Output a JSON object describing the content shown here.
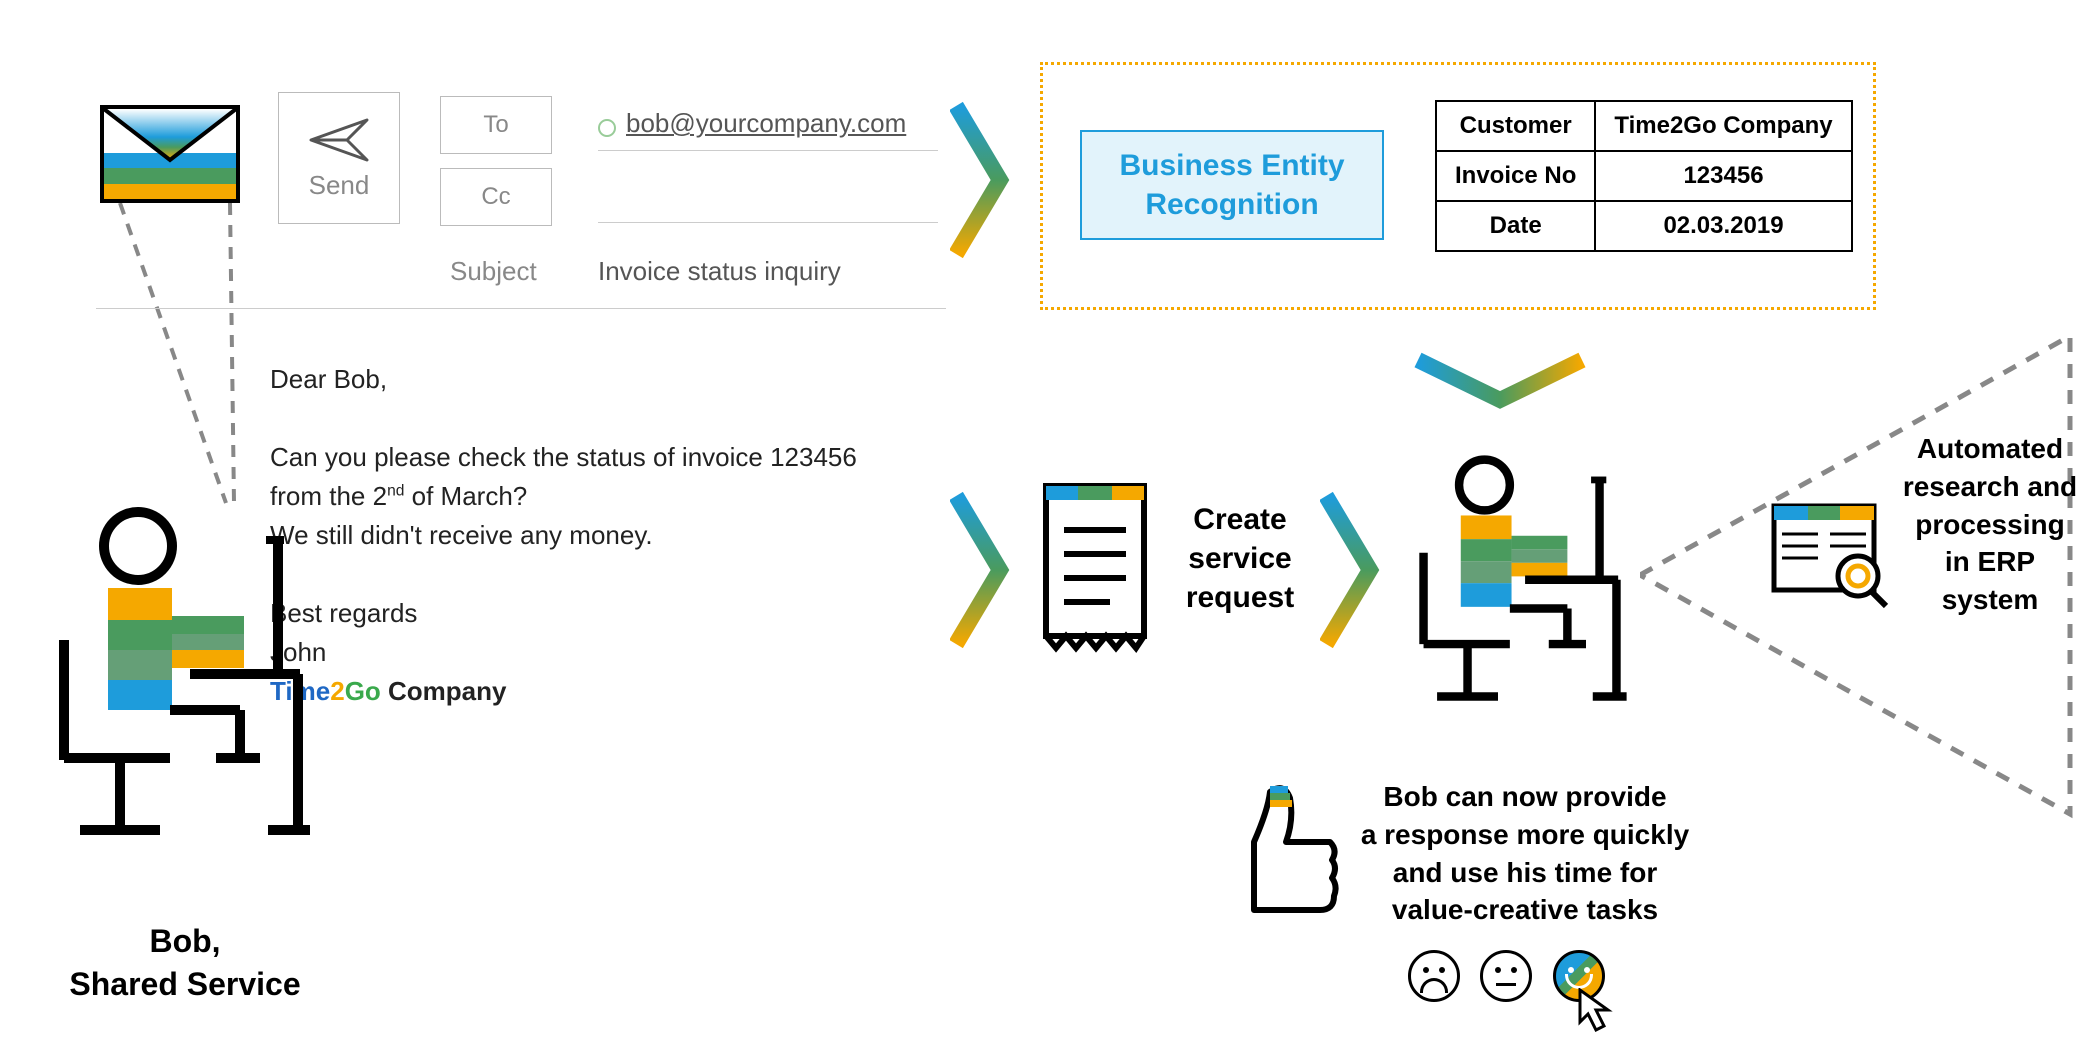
{
  "email": {
    "send": "Send",
    "to_label": "To",
    "cc_label": "Cc",
    "subject_label": "Subject",
    "to_value": "bob@yourcompany.com",
    "subject_value": "Invoice status inquiry",
    "body_greeting": "Dear Bob,",
    "body_line1": "Can you please check the status of invoice 123456",
    "body_line2_pre": "from the 2",
    "body_line2_sup": "nd",
    "body_line2_post": " of March?",
    "body_line3": "We still didn't receive any money.",
    "body_close": "Best regards",
    "body_sign": "John",
    "sig_time": "Time",
    "sig_2": "2",
    "sig_go": "Go",
    "sig_company": " Company"
  },
  "ber": {
    "title_l1": "Business Entity",
    "title_l2": "Recognition",
    "table": {
      "r0c0": "Customer",
      "r0c1": "Time2Go Company",
      "r1c0": "Invoice No",
      "r1c1": "123456",
      "r2c0": "Date",
      "r2c1": "02.03.2019"
    }
  },
  "steps": {
    "create_l1": "Create",
    "create_l2": "service",
    "create_l3": "request"
  },
  "erp": {
    "l1": "Automated",
    "l2": "research and",
    "l3": "processing",
    "l4": "in ERP",
    "l5": "system"
  },
  "benefit": {
    "l1": "Bob can now provide",
    "l2": "a response more quickly",
    "l3": "and use his time for",
    "l4": "value-creative tasks"
  },
  "persona": {
    "name": "Bob,",
    "role": "Shared Service"
  }
}
